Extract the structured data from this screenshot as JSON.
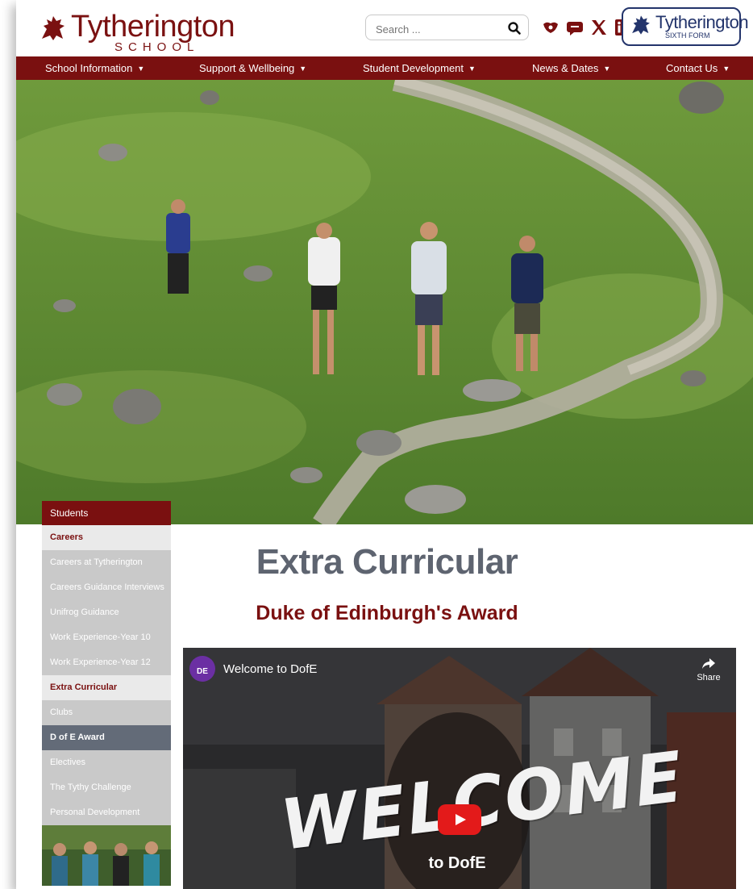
{
  "header": {
    "logo_name": "Tytherington",
    "logo_school": "SCHOOL",
    "search_placeholder": "Search ...",
    "social": [
      "sway-icon",
      "feedback-icon",
      "x-icon",
      "linkedin-icon"
    ],
    "sixth_form_name": "Tytherington",
    "sixth_form_sub": "SIXTH FORM"
  },
  "nav": {
    "items": [
      {
        "label": "School Information"
      },
      {
        "label": "Support & Wellbeing"
      },
      {
        "label": "Student Development"
      },
      {
        "label": "News & Dates"
      },
      {
        "label": "Contact Us"
      }
    ]
  },
  "sidebar": {
    "heading": "Students",
    "items": [
      {
        "label": "Careers",
        "type": "section"
      },
      {
        "label": "Careers at Tytherington",
        "type": "link"
      },
      {
        "label": "Careers Guidance Interviews",
        "type": "link"
      },
      {
        "label": "Unifrog Guidance",
        "type": "link"
      },
      {
        "label": "Work Experience-Year 10",
        "type": "link"
      },
      {
        "label": "Work Experience-Year 12",
        "type": "link"
      },
      {
        "label": "Extra Curricular",
        "type": "section"
      },
      {
        "label": "Clubs",
        "type": "link"
      },
      {
        "label": "D of E Award",
        "type": "active"
      },
      {
        "label": "Electives",
        "type": "link"
      },
      {
        "label": "The Tythy Challenge",
        "type": "link"
      },
      {
        "label": "Personal Development",
        "type": "link"
      }
    ]
  },
  "main": {
    "title": "Extra Curricular",
    "subtitle": "Duke of Edinburgh's Award"
  },
  "video": {
    "channel_badge": "DE",
    "title": "Welcome to DofE",
    "share_label": "Share",
    "overlay_big": "WELCOME",
    "overlay_small": "to DofE"
  },
  "colors": {
    "brand_maroon": "#7a1010",
    "sidebar_grey": "#c9c9c9",
    "active_grey": "#636b78",
    "title_grey": "#5e6470",
    "sixth_form_navy": "#23346b"
  }
}
